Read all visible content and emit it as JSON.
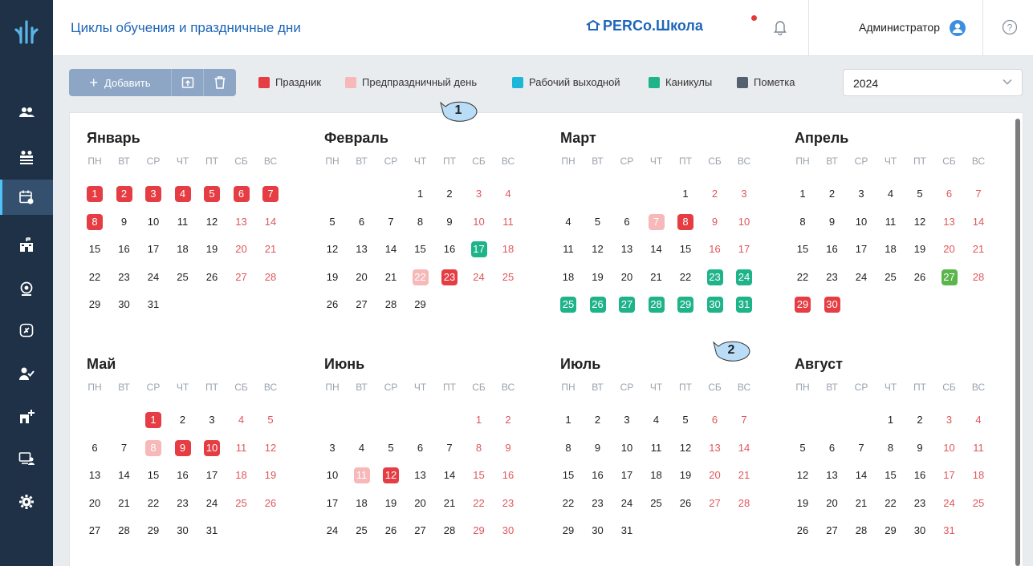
{
  "header": {
    "title": "Циклы обучения и праздничные дни",
    "brand": "PERCo.Школа",
    "user": "Администратор"
  },
  "sidebar": {
    "items": [
      "users-icon",
      "groups-icon",
      "calendar-icon",
      "school-icon",
      "access-icon",
      "lock-icon",
      "attendance-icon",
      "add-building-icon",
      "monitor-user-icon",
      "gear-icon"
    ],
    "active_index": 2
  },
  "toolbar": {
    "add_label": "Добавить"
  },
  "legend": [
    {
      "label": "Праздник",
      "color": "#e53d43"
    },
    {
      "label": "Предпраздничный день",
      "color": "#f6b8b8"
    },
    {
      "label": "Рабочий выходной",
      "color": "#1cb7d8"
    },
    {
      "label": "Каникулы",
      "color": "#1fb38a"
    },
    {
      "label": "Пометка",
      "color": "#546070"
    }
  ],
  "year_select": {
    "value": "2024"
  },
  "callouts": [
    "1",
    "2"
  ],
  "weekdays": [
    "ПН",
    "ВТ",
    "СР",
    "ЧТ",
    "ПТ",
    "СБ",
    "ВС"
  ],
  "months": [
    {
      "name": "Январь",
      "start": 0,
      "days": 31,
      "holiday": [
        1,
        2,
        3,
        4,
        5,
        6,
        7,
        8
      ],
      "pre": [],
      "vacation": [],
      "green": []
    },
    {
      "name": "Февраль",
      "start": 3,
      "days": 29,
      "holiday": [
        23
      ],
      "pre": [
        22
      ],
      "vacation": [
        17
      ],
      "green": []
    },
    {
      "name": "Март",
      "start": 4,
      "days": 31,
      "holiday": [
        8
      ],
      "pre": [
        7
      ],
      "vacation": [
        23,
        24,
        25,
        26,
        27,
        28,
        29,
        30,
        31
      ],
      "green": []
    },
    {
      "name": "Апрель",
      "start": 0,
      "days": 30,
      "holiday": [
        29,
        30
      ],
      "pre": [],
      "vacation": [],
      "green": [
        27
      ]
    },
    {
      "name": "Май",
      "start": 2,
      "days": 31,
      "holiday": [
        1,
        9,
        10
      ],
      "pre": [
        8
      ],
      "vacation": [],
      "green": []
    },
    {
      "name": "Июнь",
      "start": 5,
      "days": 30,
      "holiday": [
        12
      ],
      "pre": [
        11
      ],
      "vacation": [],
      "green": []
    },
    {
      "name": "Июль",
      "start": 0,
      "days": 31,
      "holiday": [],
      "pre": [],
      "vacation": [],
      "green": []
    },
    {
      "name": "Август",
      "start": 3,
      "days": 31,
      "holiday": [],
      "pre": [],
      "vacation": [],
      "green": []
    }
  ]
}
